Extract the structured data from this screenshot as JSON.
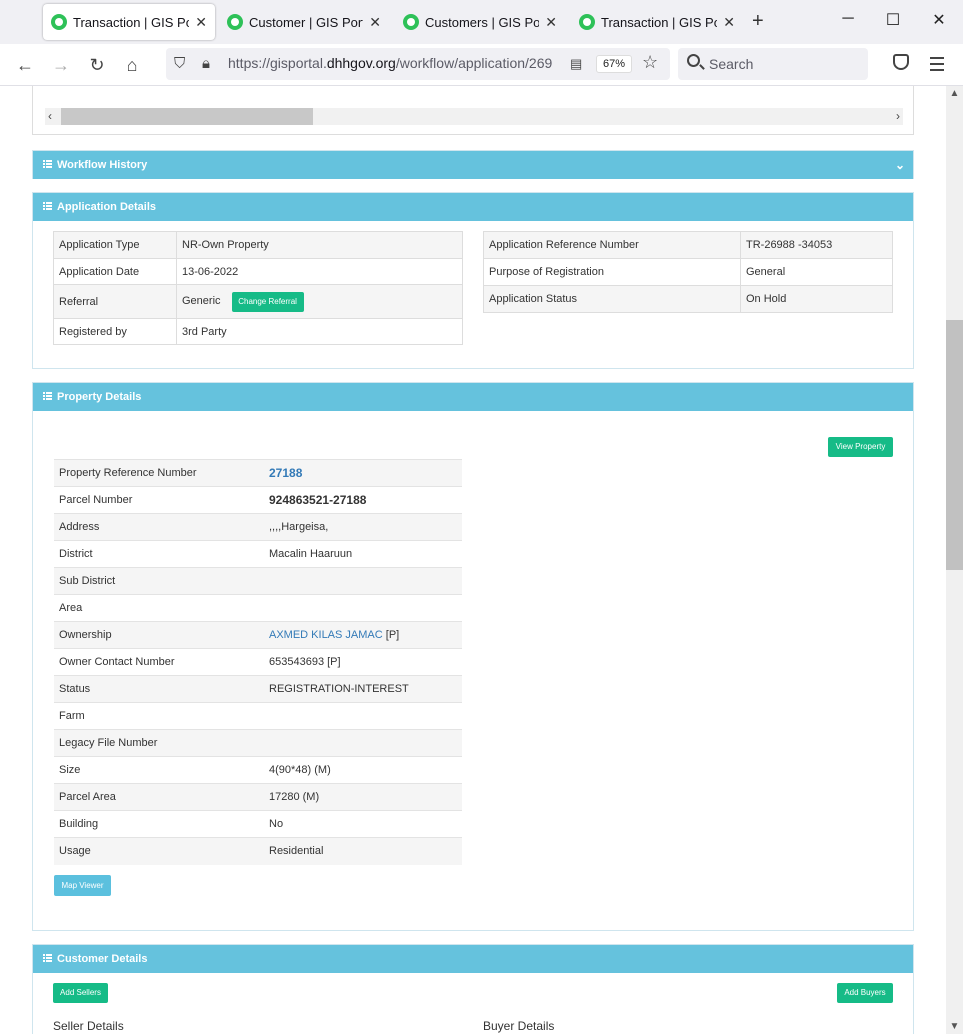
{
  "browser": {
    "tabs": [
      {
        "title": "Transaction | GIS Portal",
        "active": true
      },
      {
        "title": "Customer | GIS Portal",
        "active": false
      },
      {
        "title": "Customers | GIS Portal",
        "active": false
      },
      {
        "title": "Transaction | GIS Portal",
        "active": false
      }
    ],
    "url_prefix": "https://gisportal.",
    "url_host": "dhhgov.org",
    "url_path": "/workflow/application/269",
    "zoom": "67%",
    "search_placeholder": "Search",
    "accent": "#2ec158"
  },
  "workflow_history": {
    "title": "Workflow History"
  },
  "application_details": {
    "title": "Application Details",
    "left": [
      {
        "label": "Application Type",
        "value": "NR-Own Property"
      },
      {
        "label": "Application Date",
        "value": "13-06-2022"
      },
      {
        "label": "Referral",
        "value": "Generic"
      },
      {
        "label": "Registered by",
        "value": "3rd Party"
      }
    ],
    "change_referral_label": "Change Referral",
    "right": [
      {
        "label": "Application Reference Number",
        "value": "TR-26988 -34053"
      },
      {
        "label": "Purpose of Registration",
        "value": "General"
      },
      {
        "label": "Application Status",
        "value": "On Hold"
      }
    ]
  },
  "property_details": {
    "title": "Property Details",
    "view_property_label": "View Property",
    "rows": [
      {
        "label": "Property Reference Number",
        "value": "27188"
      },
      {
        "label": "Parcel Number",
        "value": "924863521-27188"
      },
      {
        "label": "Address",
        "value": ",,,,Hargeisa,"
      },
      {
        "label": "District",
        "value": "Macalin Haaruun"
      },
      {
        "label": "Sub District",
        "value": ""
      },
      {
        "label": "Area",
        "value": ""
      },
      {
        "label": "Ownership",
        "value": "AXMED KILAS JAMAC",
        "suffix": " [P]"
      },
      {
        "label": "Owner Contact Number",
        "value": "653543693 [P]"
      },
      {
        "label": "Status",
        "value": "REGISTRATION-INTEREST"
      },
      {
        "label": "Farm",
        "value": ""
      },
      {
        "label": "Legacy File Number",
        "value": ""
      },
      {
        "label": "Size",
        "value": "4(90*48) (M)"
      },
      {
        "label": "Parcel Area",
        "value": "17280 (M)"
      },
      {
        "label": "Building",
        "value": "No"
      },
      {
        "label": "Usage",
        "value": "Residential"
      }
    ],
    "map_viewer_label": "Map Viewer"
  },
  "customer_details": {
    "title": "Customer Details",
    "add_sellers_label": "Add Sellers",
    "add_buyers_label": "Add Buyers",
    "seller_heading": "Seller Details",
    "buyer_heading": "Buyer Details"
  },
  "colors": {
    "panel_header": "#65c2dd",
    "success_button": "#16bb87",
    "info_button": "#5bc0de",
    "link": "#337ab7"
  }
}
